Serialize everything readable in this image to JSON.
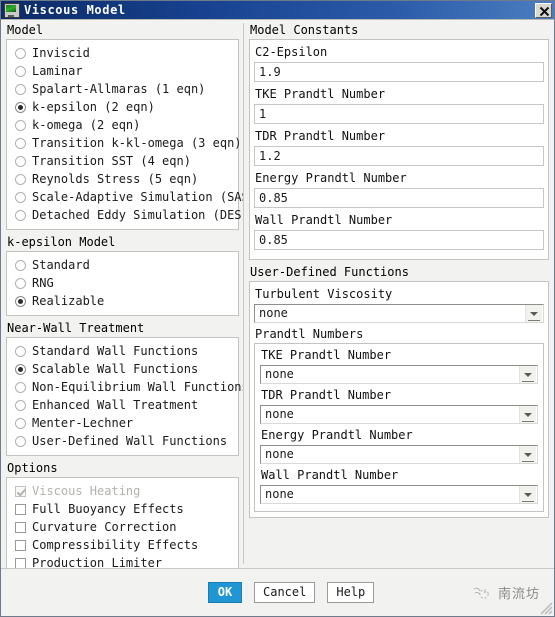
{
  "window": {
    "title": "Viscous Model",
    "icon": "monitor-icon",
    "close_label": "x"
  },
  "left": {
    "model": {
      "title": "Model",
      "items": [
        {
          "label": "Inviscid",
          "selected": false
        },
        {
          "label": "Laminar",
          "selected": false
        },
        {
          "label": "Spalart-Allmaras (1 eqn)",
          "selected": false
        },
        {
          "label": "k-epsilon (2 eqn)",
          "selected": true
        },
        {
          "label": "k-omega (2 eqn)",
          "selected": false
        },
        {
          "label": "Transition k-kl-omega (3 eqn)",
          "selected": false
        },
        {
          "label": "Transition SST (4 eqn)",
          "selected": false
        },
        {
          "label": "Reynolds Stress (5 eqn)",
          "selected": false
        },
        {
          "label": "Scale-Adaptive Simulation (SAS)",
          "selected": false
        },
        {
          "label": "Detached Eddy Simulation (DES)",
          "selected": false
        }
      ]
    },
    "k_epsilon_model": {
      "title": "k-epsilon Model",
      "items": [
        {
          "label": "Standard",
          "selected": false
        },
        {
          "label": "RNG",
          "selected": false
        },
        {
          "label": "Realizable",
          "selected": true
        }
      ]
    },
    "near_wall_treatment": {
      "title": "Near-Wall Treatment",
      "items": [
        {
          "label": "Standard Wall Functions",
          "selected": false
        },
        {
          "label": "Scalable Wall Functions",
          "selected": true
        },
        {
          "label": "Non-Equilibrium Wall Functions",
          "selected": false
        },
        {
          "label": "Enhanced Wall Treatment",
          "selected": false
        },
        {
          "label": "Menter-Lechner",
          "selected": false
        },
        {
          "label": "User-Defined Wall Functions",
          "selected": false
        }
      ]
    },
    "options": {
      "title": "Options",
      "items": [
        {
          "label": "Viscous Heating",
          "checked": true,
          "disabled": true
        },
        {
          "label": "Full Buoyancy Effects",
          "checked": false,
          "disabled": false
        },
        {
          "label": "Curvature Correction",
          "checked": false,
          "disabled": false
        },
        {
          "label": "Compressibility Effects",
          "checked": false,
          "disabled": false
        },
        {
          "label": "Production Limiter",
          "checked": false,
          "disabled": false
        }
      ]
    }
  },
  "right": {
    "model_constants": {
      "title": "Model Constants",
      "fields": [
        {
          "label": "C2-Epsilon",
          "value": "1.9"
        },
        {
          "label": "TKE Prandtl Number",
          "value": "1"
        },
        {
          "label": "TDR Prandtl Number",
          "value": "1.2"
        },
        {
          "label": "Energy Prandtl Number",
          "value": "0.85"
        },
        {
          "label": "Wall Prandtl Number",
          "value": "0.85"
        }
      ]
    },
    "udf": {
      "title": "User-Defined Functions",
      "turbulent_viscosity": {
        "label": "Turbulent Viscosity",
        "value": "none"
      },
      "prandtl_numbers": {
        "title": "Prandtl Numbers",
        "fields": [
          {
            "label": "TKE Prandtl Number",
            "value": "none"
          },
          {
            "label": "TDR Prandtl Number",
            "value": "none"
          },
          {
            "label": "Energy Prandtl Number",
            "value": "none"
          },
          {
            "label": "Wall Prandtl Number",
            "value": "none"
          }
        ]
      }
    }
  },
  "footer": {
    "ok_label": "OK",
    "cancel_label": "Cancel",
    "help_label": "Help",
    "watermark_text": "南流坊"
  },
  "colors": {
    "titlebar_start": "#0b2a66",
    "titlebar_end": "#4a7ec0",
    "primary_button": "#2196d4",
    "group_border": "#c3c3bf",
    "disabled_text": "#b2b2ae"
  }
}
